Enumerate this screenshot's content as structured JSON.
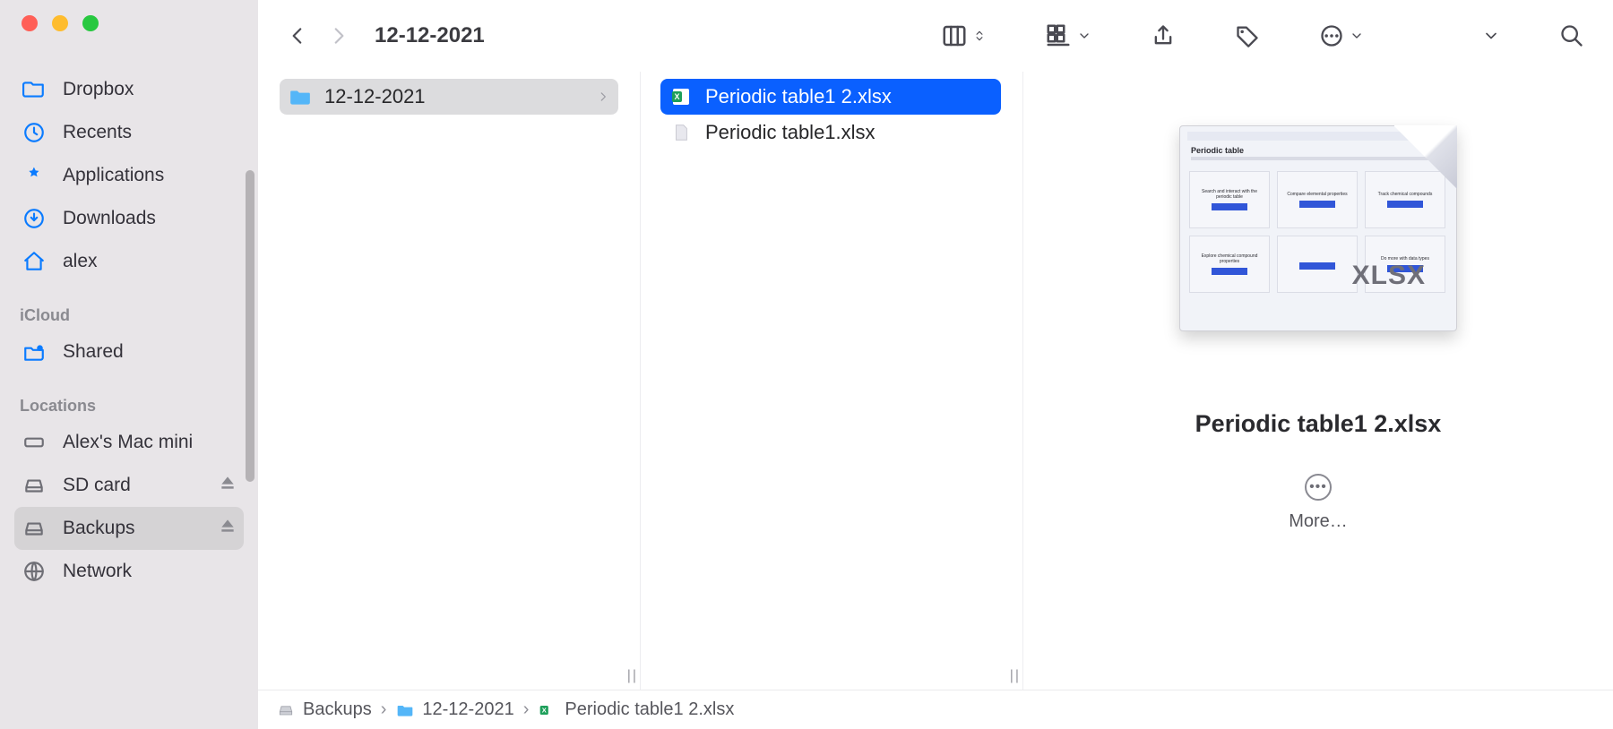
{
  "window_title": "12-12-2021",
  "sidebar": {
    "items": [
      {
        "label": "Dropbox",
        "icon": "folder"
      },
      {
        "label": "Recents",
        "icon": "clock"
      },
      {
        "label": "Applications",
        "icon": "apps"
      },
      {
        "label": "Downloads",
        "icon": "download"
      },
      {
        "label": "alex",
        "icon": "home"
      }
    ],
    "sections": {
      "icloud": {
        "title": "iCloud",
        "items": [
          {
            "label": "Shared",
            "icon": "shared"
          }
        ]
      },
      "locations": {
        "title": "Locations",
        "items": [
          {
            "label": "Alex's Mac mini",
            "icon": "machine",
            "gray": true
          },
          {
            "label": "SD card",
            "icon": "disk",
            "gray": true,
            "eject": true
          },
          {
            "label": "Backups",
            "icon": "disk",
            "gray": true,
            "eject": true,
            "selected": true
          },
          {
            "label": "Network",
            "icon": "globe",
            "gray": true
          }
        ]
      }
    }
  },
  "columns": {
    "col1": [
      {
        "label": "12-12-2021",
        "icon": "folder-open",
        "selected": "gray",
        "has_children": true
      }
    ],
    "col2": [
      {
        "label": "Periodic table1 2.xlsx",
        "icon": "xlsx",
        "selected": "blue"
      },
      {
        "label": "Periodic table1.xlsx",
        "icon": "file"
      }
    ]
  },
  "preview": {
    "filename": "Periodic table1 2.xlsx",
    "badge": "XLSX",
    "thumb_title": "Periodic table",
    "cells": [
      "Search and interact with the periodic table",
      "Compare elemental properties",
      "Track chemical compounds",
      "Explore chemical compound properties",
      "",
      "Do more with data types"
    ],
    "more_label": "More…"
  },
  "pathbar": [
    {
      "label": "Backups",
      "icon": "disk"
    },
    {
      "label": "12-12-2021",
      "icon": "folder-open"
    },
    {
      "label": "Periodic table1 2.xlsx",
      "icon": "xlsx"
    }
  ]
}
